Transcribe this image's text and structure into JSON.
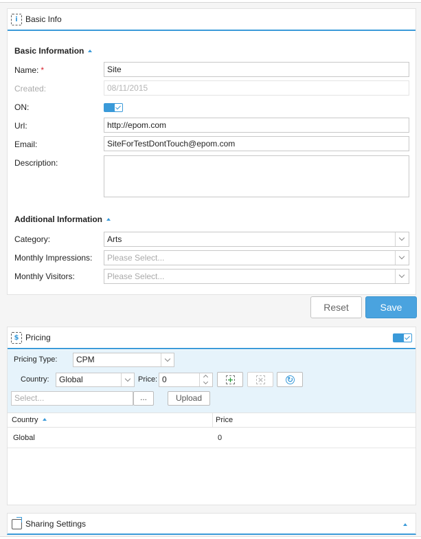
{
  "basic_info": {
    "panel_title": "Basic Info",
    "panel_icon": "info-icon",
    "section_basic": "Basic Information",
    "name_label": "Name:",
    "required_mark": "*",
    "name_value": "Site",
    "created_label": "Created:",
    "created_value": "08/11/2015",
    "on_label": "ON:",
    "on_state": true,
    "url_label": "Url:",
    "url_value": "http://epom.com",
    "email_label": "Email:",
    "email_value": "SiteForTestDontTouch@epom.com",
    "description_label": "Description:",
    "description_value": "",
    "section_additional": "Additional Information",
    "category_label": "Category:",
    "category_value": "Arts",
    "impressions_label": "Monthly Impressions:",
    "impressions_placeholder": "Please Select...",
    "visitors_label": "Monthly Visitors:",
    "visitors_placeholder": "Please Select..."
  },
  "actions": {
    "reset_label": "Reset",
    "save_label": "Save"
  },
  "pricing": {
    "panel_title": "Pricing",
    "panel_icon": "dollar-icon",
    "enabled": true,
    "pricing_type_label": "Pricing Type:",
    "pricing_type_value": "CPM",
    "country_label": "Country:",
    "country_value": "Global",
    "price_label": "Price:",
    "price_value": "0",
    "file_placeholder": "Select...",
    "browse_label": "...",
    "upload_label": "Upload",
    "grid": {
      "columns": [
        "Country",
        "Price"
      ],
      "rows": [
        {
          "country": "Global",
          "price": "0"
        }
      ]
    }
  },
  "sharing": {
    "panel_title": "Sharing Settings"
  },
  "colors": {
    "accent": "#3a9ad9",
    "save_button": "#4aa3df",
    "filter_bg": "#e6f3fb",
    "required": "#d9232d"
  }
}
